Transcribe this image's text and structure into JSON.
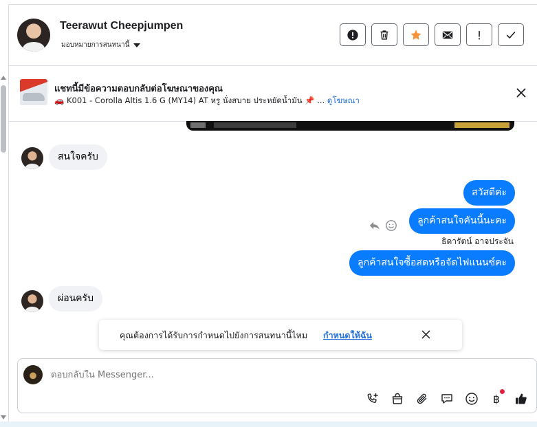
{
  "header": {
    "contact_name": "Teerawut Cheepjumpen",
    "assign_label": "มอบหมายการสนทนานี้",
    "buttons": [
      {
        "name": "report-spam-button",
        "icon": "alert-circle-icon"
      },
      {
        "name": "delete-button",
        "icon": "trash-icon"
      },
      {
        "name": "star-button",
        "icon": "star-icon"
      },
      {
        "name": "mark-unread-button",
        "icon": "envelope-icon"
      },
      {
        "name": "follow-up-button",
        "icon": "exclamation-icon"
      },
      {
        "name": "mark-done-button",
        "icon": "check-icon"
      }
    ]
  },
  "ad_banner": {
    "title": "แชทนี้มีข้อความตอบกลับต่อโฆษณาของคุณ",
    "subtitle": "🚗 K001 - Corolla Altis 1.6 G (MY14) AT หรู นั่งสบาย ประหยัดน้ำมัน 📌 ...",
    "link": "ดูโฆษณา"
  },
  "messages": {
    "incoming_1": "สนใจครับ",
    "outgoing_1": "สวัสดีค่ะ",
    "outgoing_2": "ลูกค้าสนใจคันนี้นะคะ",
    "sender_name": "ธิดารัตน์ อาจประจัน",
    "outgoing_3": "ลูกค้าสนใจซื้อสดหรือจัดไฟแนนซ์คะ",
    "incoming_2": "ผ่อนครับ"
  },
  "assign_prompt": {
    "text": "คุณต้องการได้รับการกำหนดไปยังการสนทนานี้ไหม",
    "link": "กำหนดให้ฉัน"
  },
  "composer": {
    "placeholder": "ตอบกลับใน Messenger...",
    "tools": [
      "phone-plus-icon",
      "shopping-bag-icon",
      "paperclip-icon",
      "saved-reply-icon",
      "emoji-icon",
      "baht-icon",
      "thumbs-up-icon"
    ],
    "baht_symbol": "฿"
  },
  "colors": {
    "accent": "#0a7cff",
    "link": "#216fdb",
    "star": "#f7923b",
    "incoming_bubble": "#f0f2f5"
  }
}
